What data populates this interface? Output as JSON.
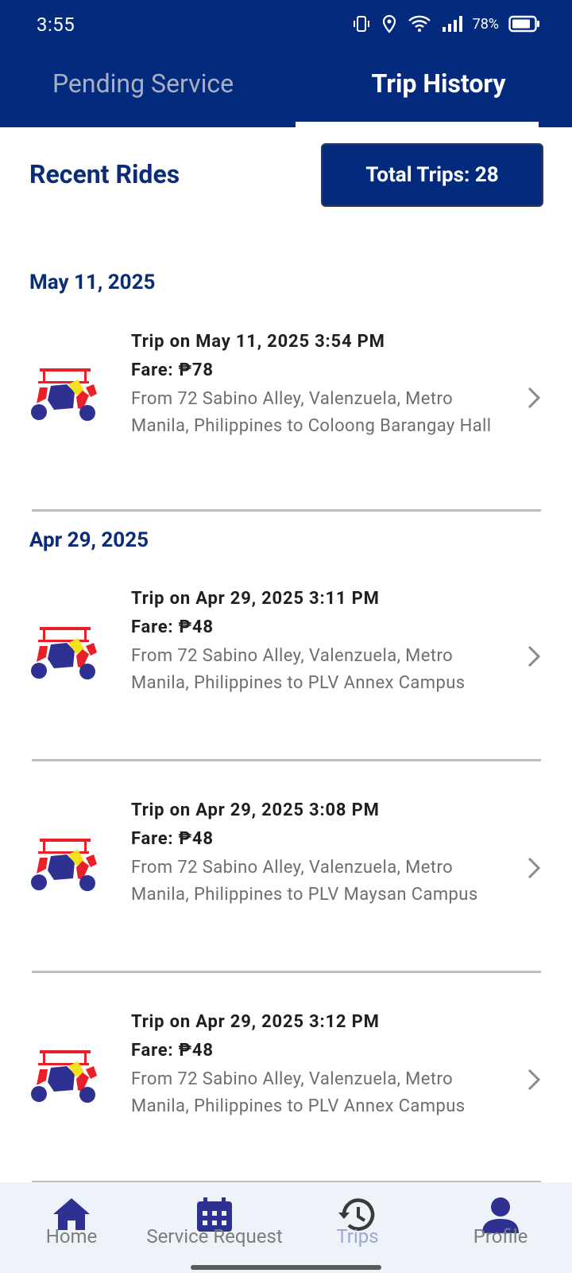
{
  "status_bar": {
    "time": "3:55",
    "battery": "78%"
  },
  "tabs": [
    {
      "label": "Pending Service"
    },
    {
      "label": "Trip History"
    }
  ],
  "header": {
    "title": "Recent Rides",
    "total_trips": "Total Trips: 28"
  },
  "groups": [
    {
      "date": "May 11, 2025"
    },
    {
      "date": "Apr 29, 2025"
    }
  ],
  "trips": [
    {
      "title": "Trip on May 11, 2025 3:54 PM",
      "fare": "Fare: ₱78",
      "route": "From 72 Sabino Alley, Valenzuela, Metro Manila, Philippines to Coloong Barangay Hall"
    },
    {
      "title": "Trip on Apr 29, 2025 3:11 PM",
      "fare": "Fare: ₱48",
      "route": "From 72 Sabino Alley, Valenzuela, Metro Manila, Philippines to PLV Annex Campus"
    },
    {
      "title": "Trip on Apr 29, 2025 3:08 PM",
      "fare": "Fare: ₱48",
      "route": "From 72 Sabino Alley, Valenzuela, Metro Manila, Philippines to PLV Maysan Campus"
    },
    {
      "title": "Trip on Apr 29, 2025 3:12 PM",
      "fare": "Fare: ₱48",
      "route": "From 72 Sabino Alley, Valenzuela, Metro Manila, Philippines to PLV Annex Campus"
    }
  ],
  "bottom_nav": [
    {
      "label": "Home",
      "icon": "home-icon"
    },
    {
      "label": "Service Request",
      "icon": "calendar-icon"
    },
    {
      "label": "Trips",
      "icon": "history-icon"
    },
    {
      "label": "Profile",
      "icon": "person-icon"
    }
  ],
  "colors": {
    "primary": "#032a7c",
    "accent_text": "#0b2d78",
    "nav_bg": "#eef3fa"
  }
}
